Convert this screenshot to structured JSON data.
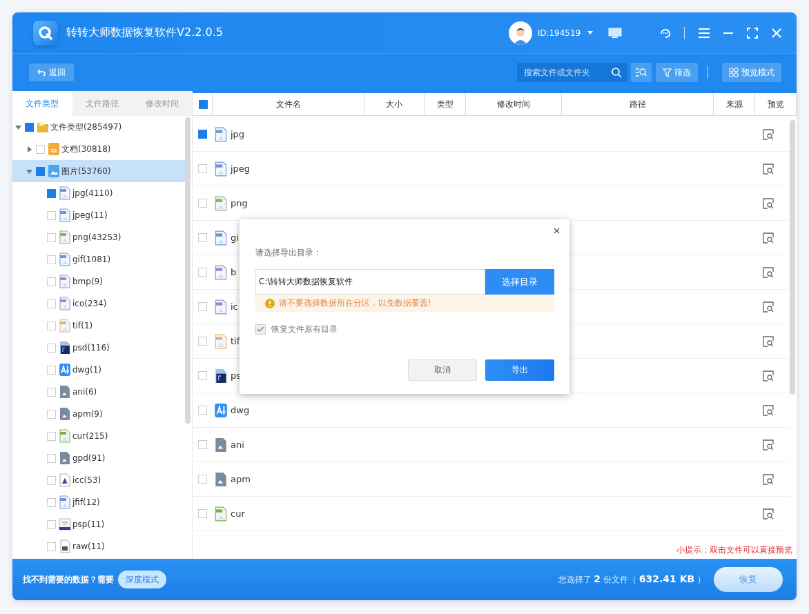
{
  "window": {
    "title": "转转大师数据恢复软件V2.2.0.5",
    "user_id": "ID:194519"
  },
  "toolbar": {
    "back": "返回",
    "search": {
      "placeholder": "搜索文件或文件夹"
    },
    "filter": "筛选",
    "view_mode": "预览模式"
  },
  "side_tabs": [
    {
      "label": "文件类型",
      "selected": true
    },
    {
      "label": "文件路径",
      "selected": false
    },
    {
      "label": "修改时间",
      "selected": false
    }
  ],
  "tree": [
    {
      "label": "文件类型(285497)",
      "kind": "folder",
      "checked": true,
      "expanded": true,
      "selected": false,
      "children": [
        {
          "label": "文档(30818)",
          "kind": "doc",
          "checked": false,
          "expanded": false,
          "selected": false
        },
        {
          "label": "图片(53760)",
          "kind": "image",
          "checked": true,
          "expanded": true,
          "selected": true,
          "children": [
            {
              "label": "jpg(4110)",
              "kind": "jpg",
              "checked": true,
              "selected": false
            },
            {
              "label": "jpeg(11)",
              "kind": "jpg",
              "checked": false,
              "selected": false
            },
            {
              "label": "png(43253)",
              "kind": "png",
              "checked": false,
              "selected": false
            },
            {
              "label": "gif(1081)",
              "kind": "jpg",
              "checked": false,
              "selected": false
            },
            {
              "label": "bmp(9)",
              "kind": "bmp",
              "checked": false,
              "selected": false
            },
            {
              "label": "ico(234)",
              "kind": "bmp",
              "checked": false,
              "selected": false
            },
            {
              "label": "tif(1)",
              "kind": "tif",
              "checked": false,
              "selected": false
            },
            {
              "label": "psd(116)",
              "kind": "psd",
              "checked": false,
              "selected": false
            },
            {
              "label": "dwg(1)",
              "kind": "dwg",
              "checked": false,
              "selected": false
            },
            {
              "label": "ani(6)",
              "kind": "gray",
              "checked": false,
              "selected": false
            },
            {
              "label": "apm(9)",
              "kind": "gray",
              "checked": false,
              "selected": false
            },
            {
              "label": "cur(215)",
              "kind": "cur",
              "checked": false,
              "selected": false
            },
            {
              "label": "gpd(91)",
              "kind": "gray",
              "checked": false,
              "selected": false
            },
            {
              "label": "icc(53)",
              "kind": "icc",
              "checked": false,
              "selected": false
            },
            {
              "label": "jfif(12)",
              "kind": "jpg",
              "checked": false,
              "selected": false
            },
            {
              "label": "psp(11)",
              "kind": "psp",
              "checked": false,
              "selected": false
            },
            {
              "label": "raw(11)",
              "kind": "raw",
              "checked": false,
              "selected": false
            }
          ]
        }
      ]
    }
  ],
  "table": {
    "all_checked": true,
    "columns": [
      "文件名",
      "大小",
      "类型",
      "修改时间",
      "路径",
      "来源",
      "预览"
    ],
    "rows": [
      {
        "name": "jpg",
        "kind": "jpg",
        "checked": true
      },
      {
        "name": "jpeg",
        "kind": "jpg",
        "checked": false
      },
      {
        "name": "png",
        "kind": "png",
        "checked": false
      },
      {
        "name": "gi",
        "kind": "jpg",
        "checked": false
      },
      {
        "name": "b",
        "kind": "bmp",
        "checked": false
      },
      {
        "name": "ic",
        "kind": "bmp",
        "checked": false
      },
      {
        "name": "tif",
        "kind": "tif",
        "checked": false
      },
      {
        "name": "ps",
        "kind": "psd",
        "checked": false
      },
      {
        "name": "dwg",
        "kind": "dwg",
        "checked": false
      },
      {
        "name": "ani",
        "kind": "gray",
        "checked": false
      },
      {
        "name": "apm",
        "kind": "gray",
        "checked": false
      },
      {
        "name": "cur",
        "kind": "cur",
        "checked": false
      }
    ]
  },
  "tip": "小提示：双击文件可以直接预览",
  "dialog": {
    "label": "请选择导出目录：",
    "path": "C:\\转转大师数据恢复软件",
    "browse": "选择目录",
    "warning": "请不要选择数据所在分区，以免数据覆盖!",
    "keep_structure": {
      "label": "恢复文件原有目录",
      "checked": true,
      "disabled": true
    },
    "cancel": "取消",
    "export": "导出"
  },
  "footer": {
    "hint": "找不到需要的数据？需要",
    "deep_mode": "深度模式",
    "summary": "您选择了 **2** 份文件（ **632.41 KB** ）",
    "recover": "恢复"
  }
}
